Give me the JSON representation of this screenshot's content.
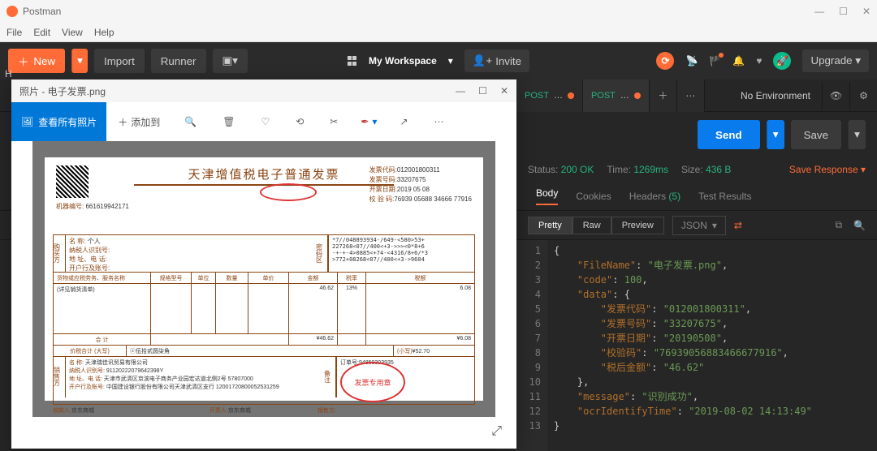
{
  "app": {
    "title": "Postman",
    "menu": [
      "File",
      "Edit",
      "View",
      "Help"
    ],
    "titlebar_controls": {
      "min": "—",
      "max": "☐",
      "close": "✕"
    }
  },
  "toolbar": {
    "new_label": "New",
    "import_label": "Import",
    "runner_label": "Runner",
    "workspace_label": "My Workspace",
    "invite_label": "Invite",
    "upgrade_label": "Upgrade"
  },
  "env": {
    "selected": "No Environment"
  },
  "tabs": [
    {
      "method": "POST",
      "label": "POST ...",
      "dirty": true
    },
    {
      "method": "POST",
      "label": "POST ...",
      "dirty": true,
      "active": true
    }
  ],
  "request": {
    "send_label": "Send",
    "save_label": "Save"
  },
  "response": {
    "status_label": "Status:",
    "status_value": "200 OK",
    "time_label": "Time:",
    "time_value": "1269ms",
    "size_label": "Size:",
    "size_value": "436 B",
    "save_response": "Save Response",
    "tabs": {
      "body": "Body",
      "cookies": "Cookies",
      "headers": "Headers",
      "headers_count": "(5)",
      "tests": "Test Results"
    },
    "format": {
      "pretty": "Pretty",
      "raw": "Raw",
      "preview": "Preview",
      "lang": "JSON"
    }
  },
  "json_response": {
    "line1": "{",
    "line2_key": "\"FileName\"",
    "line2_val": "\"电子发票.png\"",
    "line3_key": "\"code\"",
    "line3_val": "100",
    "line4_key": "\"data\"",
    "line4_val": "{",
    "line5_key": "\"发票代码\"",
    "line5_val": "\"012001800311\"",
    "line6_key": "\"发票号码\"",
    "line6_val": "\"33207675\"",
    "line7_key": "\"开票日期\"",
    "line7_val": "\"20190508\"",
    "line8_key": "\"校验码\"",
    "line8_val": "\"76939056883466677916\"",
    "line9_key": "\"税后金额\"",
    "line9_val": "\"46.62\"",
    "line10_val": "},",
    "line11_key": "\"message\"",
    "line11_val": "\"识别成功\"",
    "line12_key": "\"ocrIdentifyTime\"",
    "line12_val": "\"2019-08-02 14:13:49\"",
    "line13_val": "}"
  },
  "photos": {
    "title": "照片 - 电子发票.png",
    "viewall": "查看所有照片",
    "addto": "添加到",
    "controls": {
      "min": "—",
      "max": "☐",
      "close": "✕"
    }
  },
  "invoice": {
    "title": "天津增值税电子普通发票",
    "top_right": {
      "code_label": "发票代码:",
      "code": "012001800311",
      "num_label": "发票号码:",
      "num": "33207675",
      "date_label": "开票日期:",
      "date": "2019  05  08",
      "check_label": "校 验 码:",
      "check": "76939 05688 34666 77916"
    },
    "machine_label": "机器编号:",
    "machine": "661619942171",
    "buyer": {
      "title": "购买方",
      "name_label": "名   称:",
      "name": "个人",
      "tax_label": "纳税人识别号:",
      "addr_label": "地 址、电 话:",
      "bank_label": "开户行及账号:"
    },
    "cipher_title": "密码区",
    "cipher": "*7//048893934-/649-<580>53+\n227268<07//400<+3->>><0*8+6\n-+-+-4>0885<+74-<4316/8+6/*3\n>772+08268<07//400<+3->9604",
    "table_headers": [
      "货物或应税劳务、服务名称",
      "规格型号",
      "单位",
      "数量",
      "单价",
      "金额",
      "税率",
      "税额"
    ],
    "item_name": "(详见销货清单)",
    "item_amount": "46.62",
    "item_rate": "13%",
    "item_tax": "6.08",
    "total_label": "合  计",
    "total_amount": "¥46.62",
    "total_tax": "¥6.08",
    "cn_label": "价税合计 (大写)",
    "cn_amount": "ⓧ伍拾贰圆柒角",
    "small_label": "(小写)",
    "small_amount": "¥52.70",
    "order_label": "订单号:",
    "order": "94859303935",
    "seller": {
      "title": "销售方",
      "name_label": "名   称:",
      "name": "天津瑞佳讯贸易有限公司",
      "tax_label": "纳税人识别号:",
      "tax": "91120222079642398Y",
      "addr_label": "地 址、电 话:",
      "addr": "天津市武清区京滨电子商务产业园宏达道北侧2号 57807000",
      "bank_label": "开户行及账号:",
      "bank": "中国建设银行股份有限公司天津武清区支行 12001720800052531259"
    },
    "payee_label": "收款人:",
    "payee": "京东商城",
    "review_label": "开票人:",
    "review": "京东商城",
    "seller_seal_label": "销售方:",
    "seal_text": "发票专用章"
  }
}
